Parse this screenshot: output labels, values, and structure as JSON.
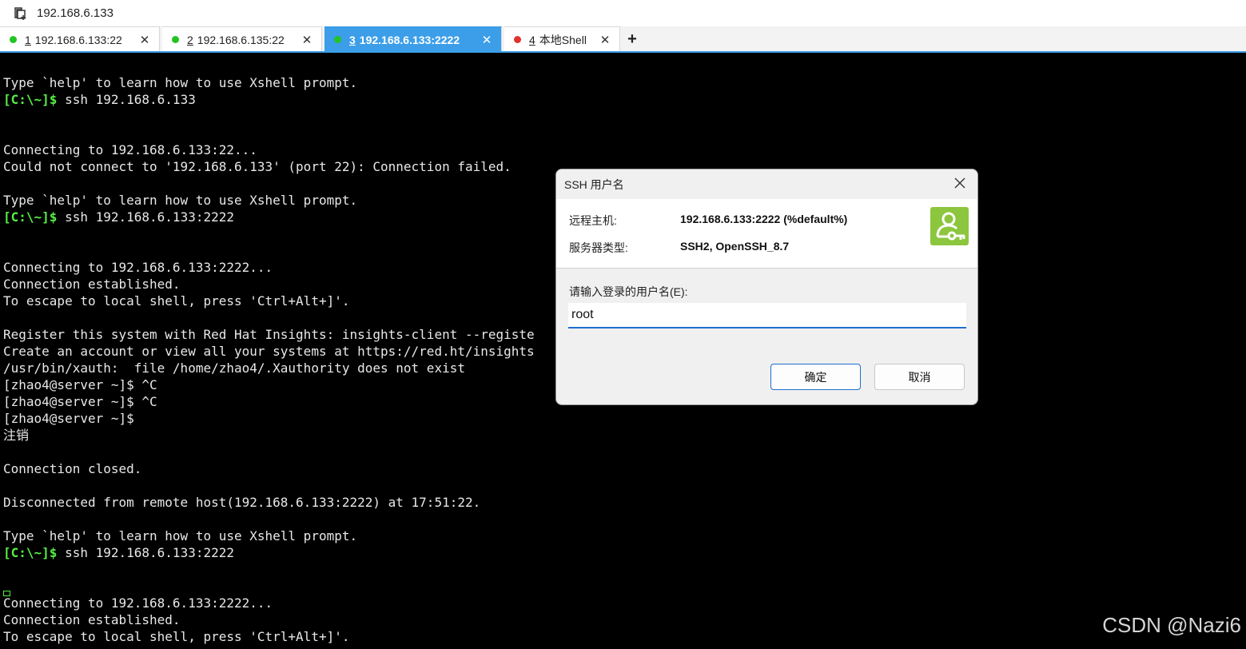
{
  "address_bar": {
    "text": "192.168.6.133",
    "icon": "new-session-icon"
  },
  "tabs": [
    {
      "num": "1",
      "label": "192.168.6.133:22",
      "status_color": "#22c422",
      "active": false
    },
    {
      "num": "2",
      "label": "192.168.6.135:22",
      "status_color": "#22c422",
      "active": false
    },
    {
      "num": "3",
      "label": "192.168.6.133:2222",
      "status_color": "#22c422",
      "active": true
    },
    {
      "num": "4",
      "label": "本地Shell",
      "status_color": "#e0322e",
      "active": false
    }
  ],
  "tab_close_glyph": "✕",
  "tab_add_glyph": "+",
  "accent_color": "#3c9ee8",
  "terminal": {
    "prompt_text": "[C:\\~]$",
    "lines": [
      {
        "text": "Type `help' to learn how to use Xshell prompt."
      },
      {
        "prompt": "[C:\\~]$",
        "text": " ssh 192.168.6.133"
      },
      {
        "text": ""
      },
      {
        "text": ""
      },
      {
        "text": "Connecting to 192.168.6.133:22..."
      },
      {
        "text": "Could not connect to '192.168.6.133' (port 22): Connection failed."
      },
      {
        "text": ""
      },
      {
        "text": "Type `help' to learn how to use Xshell prompt."
      },
      {
        "prompt": "[C:\\~]$",
        "text": " ssh 192.168.6.133:2222"
      },
      {
        "text": ""
      },
      {
        "text": ""
      },
      {
        "text": "Connecting to 192.168.6.133:2222..."
      },
      {
        "text": "Connection established."
      },
      {
        "text": "To escape to local shell, press 'Ctrl+Alt+]'."
      },
      {
        "text": ""
      },
      {
        "text": "Register this system with Red Hat Insights: insights-client --registe"
      },
      {
        "text": "Create an account or view all your systems at https://red.ht/insights"
      },
      {
        "text": "/usr/bin/xauth:  file /home/zhao4/.Xauthority does not exist"
      },
      {
        "text": "[zhao4@server ~]$ ^C"
      },
      {
        "text": "[zhao4@server ~]$ ^C"
      },
      {
        "text": "[zhao4@server ~]$"
      },
      {
        "text": "注销"
      },
      {
        "text": ""
      },
      {
        "text": "Connection closed."
      },
      {
        "text": ""
      },
      {
        "text": "Disconnected from remote host(192.168.6.133:2222) at 17:51:22."
      },
      {
        "text": ""
      },
      {
        "text": "Type `help' to learn how to use Xshell prompt."
      },
      {
        "prompt": "[C:\\~]$",
        "text": " ssh 192.168.6.133:2222"
      },
      {
        "text": ""
      },
      {
        "text": ""
      },
      {
        "text": "Connecting to 192.168.6.133:2222..."
      },
      {
        "text": "Connection established."
      },
      {
        "text": "To escape to local shell, press 'Ctrl+Alt+]'."
      }
    ]
  },
  "watermark": "CSDN @Nazi6",
  "dialog": {
    "title": "SSH 用户名",
    "close_glyph": "✕",
    "remote_host_label": "远程主机:",
    "remote_host_value": "192.168.6.133:2222 (%default%)",
    "server_type_label": "服务器类型:",
    "server_type_value": "SSH2, OpenSSH_8.7",
    "username_prompt": "请输入登录的用户名(E):",
    "username_value": "root",
    "ok_label": "确定",
    "cancel_label": "取消",
    "icon": "user-key-icon",
    "icon_color": "#8cc63e"
  }
}
